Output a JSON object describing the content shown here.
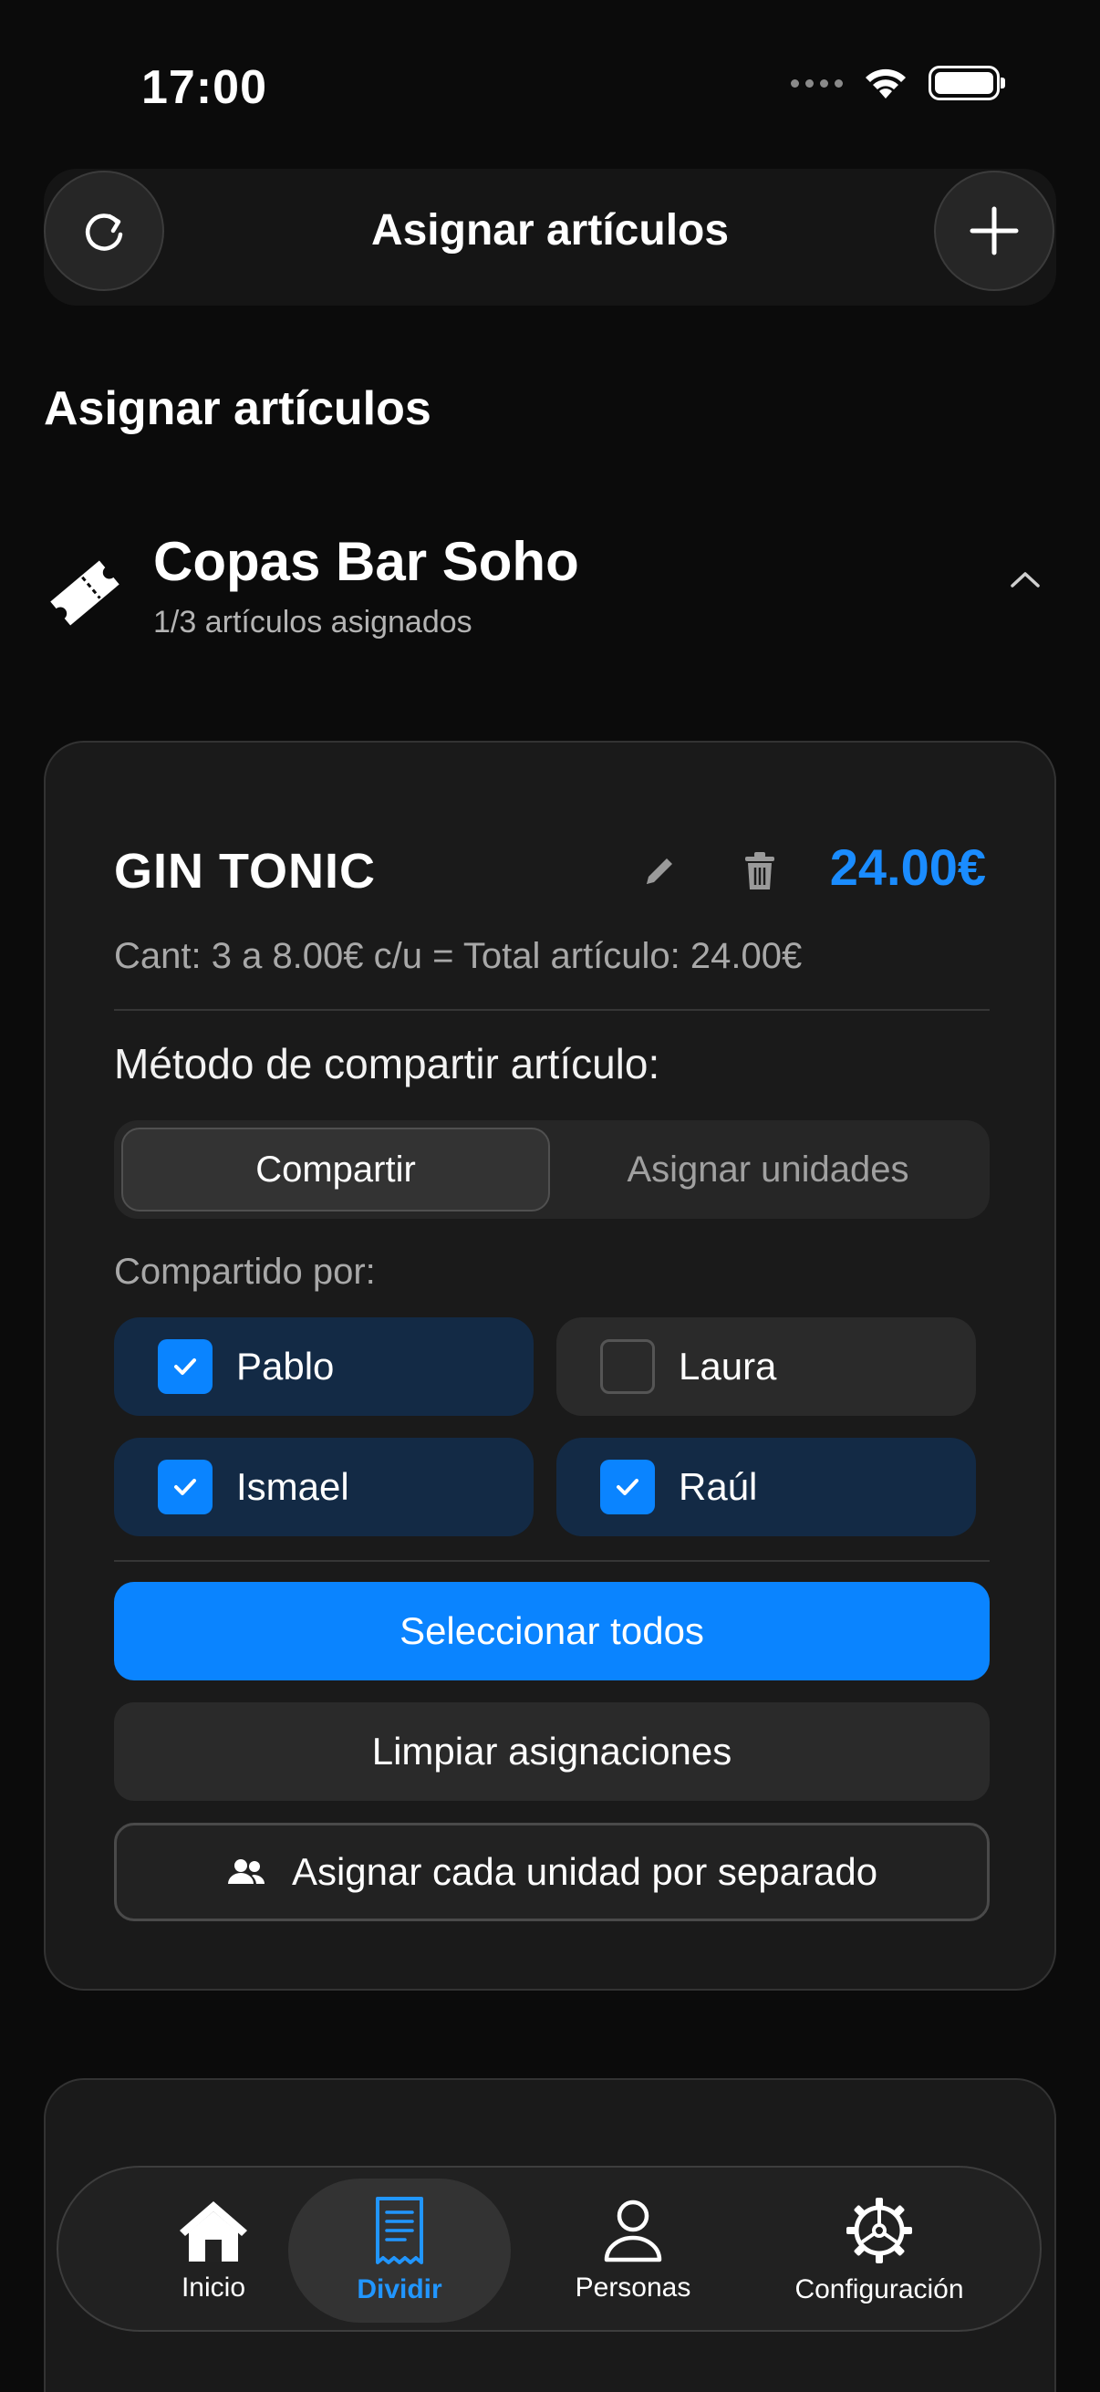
{
  "status_bar": {
    "time": "17:00"
  },
  "header": {
    "title": "Asignar artículos",
    "refresh_icon": "refresh-icon",
    "add_icon": "plus-icon"
  },
  "section": {
    "title": "Asignar artículos"
  },
  "ticket": {
    "name": "Copas Bar Soho",
    "subtitle": "1/3 artículos asignados",
    "icon": "ticket-icon"
  },
  "item": {
    "name": "GIN TONIC",
    "price": "24.00€",
    "detail": "Cant: 3 a 8.00€ c/u = Total artículo: 24.00€",
    "method_label": "Método de compartir artículo:",
    "methods": [
      {
        "label": "Compartir",
        "selected": true
      },
      {
        "label": "Asignar unidades",
        "selected": false
      }
    ],
    "shared_label": "Compartido por:",
    "people": [
      {
        "name": "Pablo",
        "checked": true
      },
      {
        "name": "Laura",
        "checked": false
      },
      {
        "name": "Ismael",
        "checked": true
      },
      {
        "name": "Raúl",
        "checked": true
      }
    ],
    "select_all": "Seleccionar todos",
    "clear": "Limpiar asignaciones",
    "assign_each": "Asignar cada unidad por separado"
  },
  "tab_bar": {
    "items": [
      {
        "label": "Inicio",
        "icon": "home-icon",
        "active": false
      },
      {
        "label": "Dividir",
        "icon": "receipt-icon",
        "active": true
      },
      {
        "label": "Personas",
        "icon": "person-icon",
        "active": false
      },
      {
        "label": "Configuración",
        "icon": "gear-icon",
        "active": false
      }
    ]
  },
  "colors": {
    "accent": "#0a84ff",
    "price": "#1a8cff",
    "background": "#0b0b0b",
    "card": "#1a1a1a"
  }
}
